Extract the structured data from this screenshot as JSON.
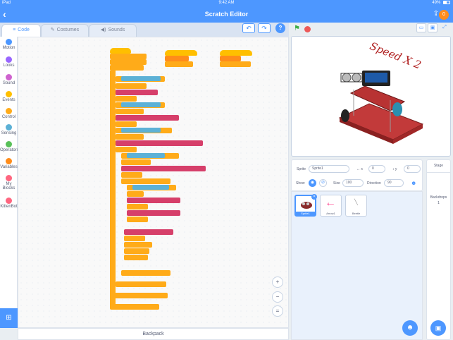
{
  "status": {
    "device": "iPad",
    "time": "9:42 AM",
    "battery": "49%"
  },
  "header": {
    "title": "Scratch Editor",
    "notifications": "0"
  },
  "tabs": [
    {
      "label": "Code",
      "icon": "code-icon"
    },
    {
      "label": "Costumes",
      "icon": "brush-icon"
    },
    {
      "label": "Sounds",
      "icon": "speaker-icon"
    }
  ],
  "categories": [
    {
      "label": "Motion",
      "color": "#4c97ff"
    },
    {
      "label": "Looks",
      "color": "#9966ff"
    },
    {
      "label": "Sound",
      "color": "#cf63cf"
    },
    {
      "label": "Events",
      "color": "#ffbf00"
    },
    {
      "label": "Control",
      "color": "#ffab19"
    },
    {
      "label": "Sensing",
      "color": "#5cb1d6"
    },
    {
      "label": "Operators",
      "color": "#59c059"
    },
    {
      "label": "Variables",
      "color": "#ff8c1a"
    },
    {
      "label": "My Blocks",
      "color": "#ff6680"
    },
    {
      "label": "KittenBot",
      "color": "#ff6680"
    }
  ],
  "backpack": {
    "label": "Backpack"
  },
  "stage": {
    "overlay_text": "Speed X 2"
  },
  "sprite_info": {
    "sprite_label": "Sprite",
    "sprite_name": "Sprite1",
    "x": "0",
    "y": "0",
    "show_label": "Show",
    "size_label": "Size",
    "size": "100",
    "direction_label": "Direction",
    "direction": "90"
  },
  "sprites": [
    {
      "name": "Sprite1",
      "selected": true
    },
    {
      "name": "Arrow1",
      "selected": false
    },
    {
      "name": "Beetle",
      "selected": false
    }
  ],
  "stage_panel": {
    "title": "Stage",
    "backdrops_label": "Backdrops",
    "backdrops_count": "1"
  },
  "colors": {
    "accent": "#4d97ff",
    "events": "#ffbf00",
    "control": "#ffab19",
    "extension": "#d63f6a"
  }
}
